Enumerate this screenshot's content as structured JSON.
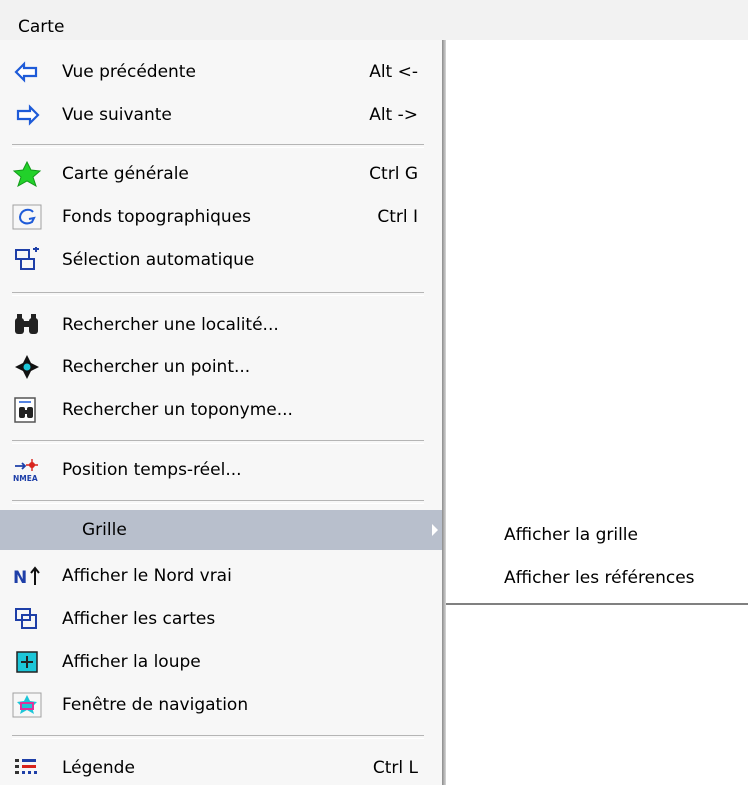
{
  "menubar": {
    "title": "Carte"
  },
  "menu": {
    "items": [
      {
        "label": "Vue précédente",
        "shortcut": "Alt <-",
        "icon": "arrow-left-icon"
      },
      {
        "label": "Vue suivante",
        "shortcut": "Alt ->",
        "icon": "arrow-right-icon"
      },
      {
        "label": "Carte générale",
        "shortcut": "Ctrl G",
        "icon": "france-map-icon"
      },
      {
        "label": "Fonds topographiques",
        "shortcut": "Ctrl I",
        "icon": "topo-swirl-icon"
      },
      {
        "label": "Sélection automatique",
        "shortcut": "",
        "icon": "auto-select-icon"
      },
      {
        "label": "Rechercher une localité...",
        "shortcut": "",
        "icon": "binoculars-icon"
      },
      {
        "label": "Rechercher un point...",
        "shortcut": "",
        "icon": "crosshair-icon"
      },
      {
        "label": "Rechercher un toponyme...",
        "shortcut": "",
        "icon": "toponym-search-icon"
      },
      {
        "label": "Position temps-réel...",
        "shortcut": "",
        "icon": "nmea-gps-icon"
      },
      {
        "label": "Grille",
        "shortcut": "",
        "icon": ""
      },
      {
        "label": "Afficher le Nord vrai",
        "shortcut": "",
        "icon": "north-arrow-icon"
      },
      {
        "label": "Afficher les cartes",
        "shortcut": "",
        "icon": "maps-overlay-icon"
      },
      {
        "label": "Afficher la loupe",
        "shortcut": "",
        "icon": "magnifier-box-icon"
      },
      {
        "label": "Fenêtre de navigation",
        "shortcut": "",
        "icon": "navigation-window-icon"
      },
      {
        "label": "Légende",
        "shortcut": "Ctrl L",
        "icon": "legend-icon"
      }
    ]
  },
  "submenu": {
    "items": [
      {
        "label": "Afficher la grille"
      },
      {
        "label": "Afficher les références"
      }
    ]
  },
  "colors": {
    "highlight": "#b8bfcc",
    "menu_bg": "#f7f7f7",
    "arrow_blue": "#1e5bd8",
    "star_green": "#22d12a"
  }
}
